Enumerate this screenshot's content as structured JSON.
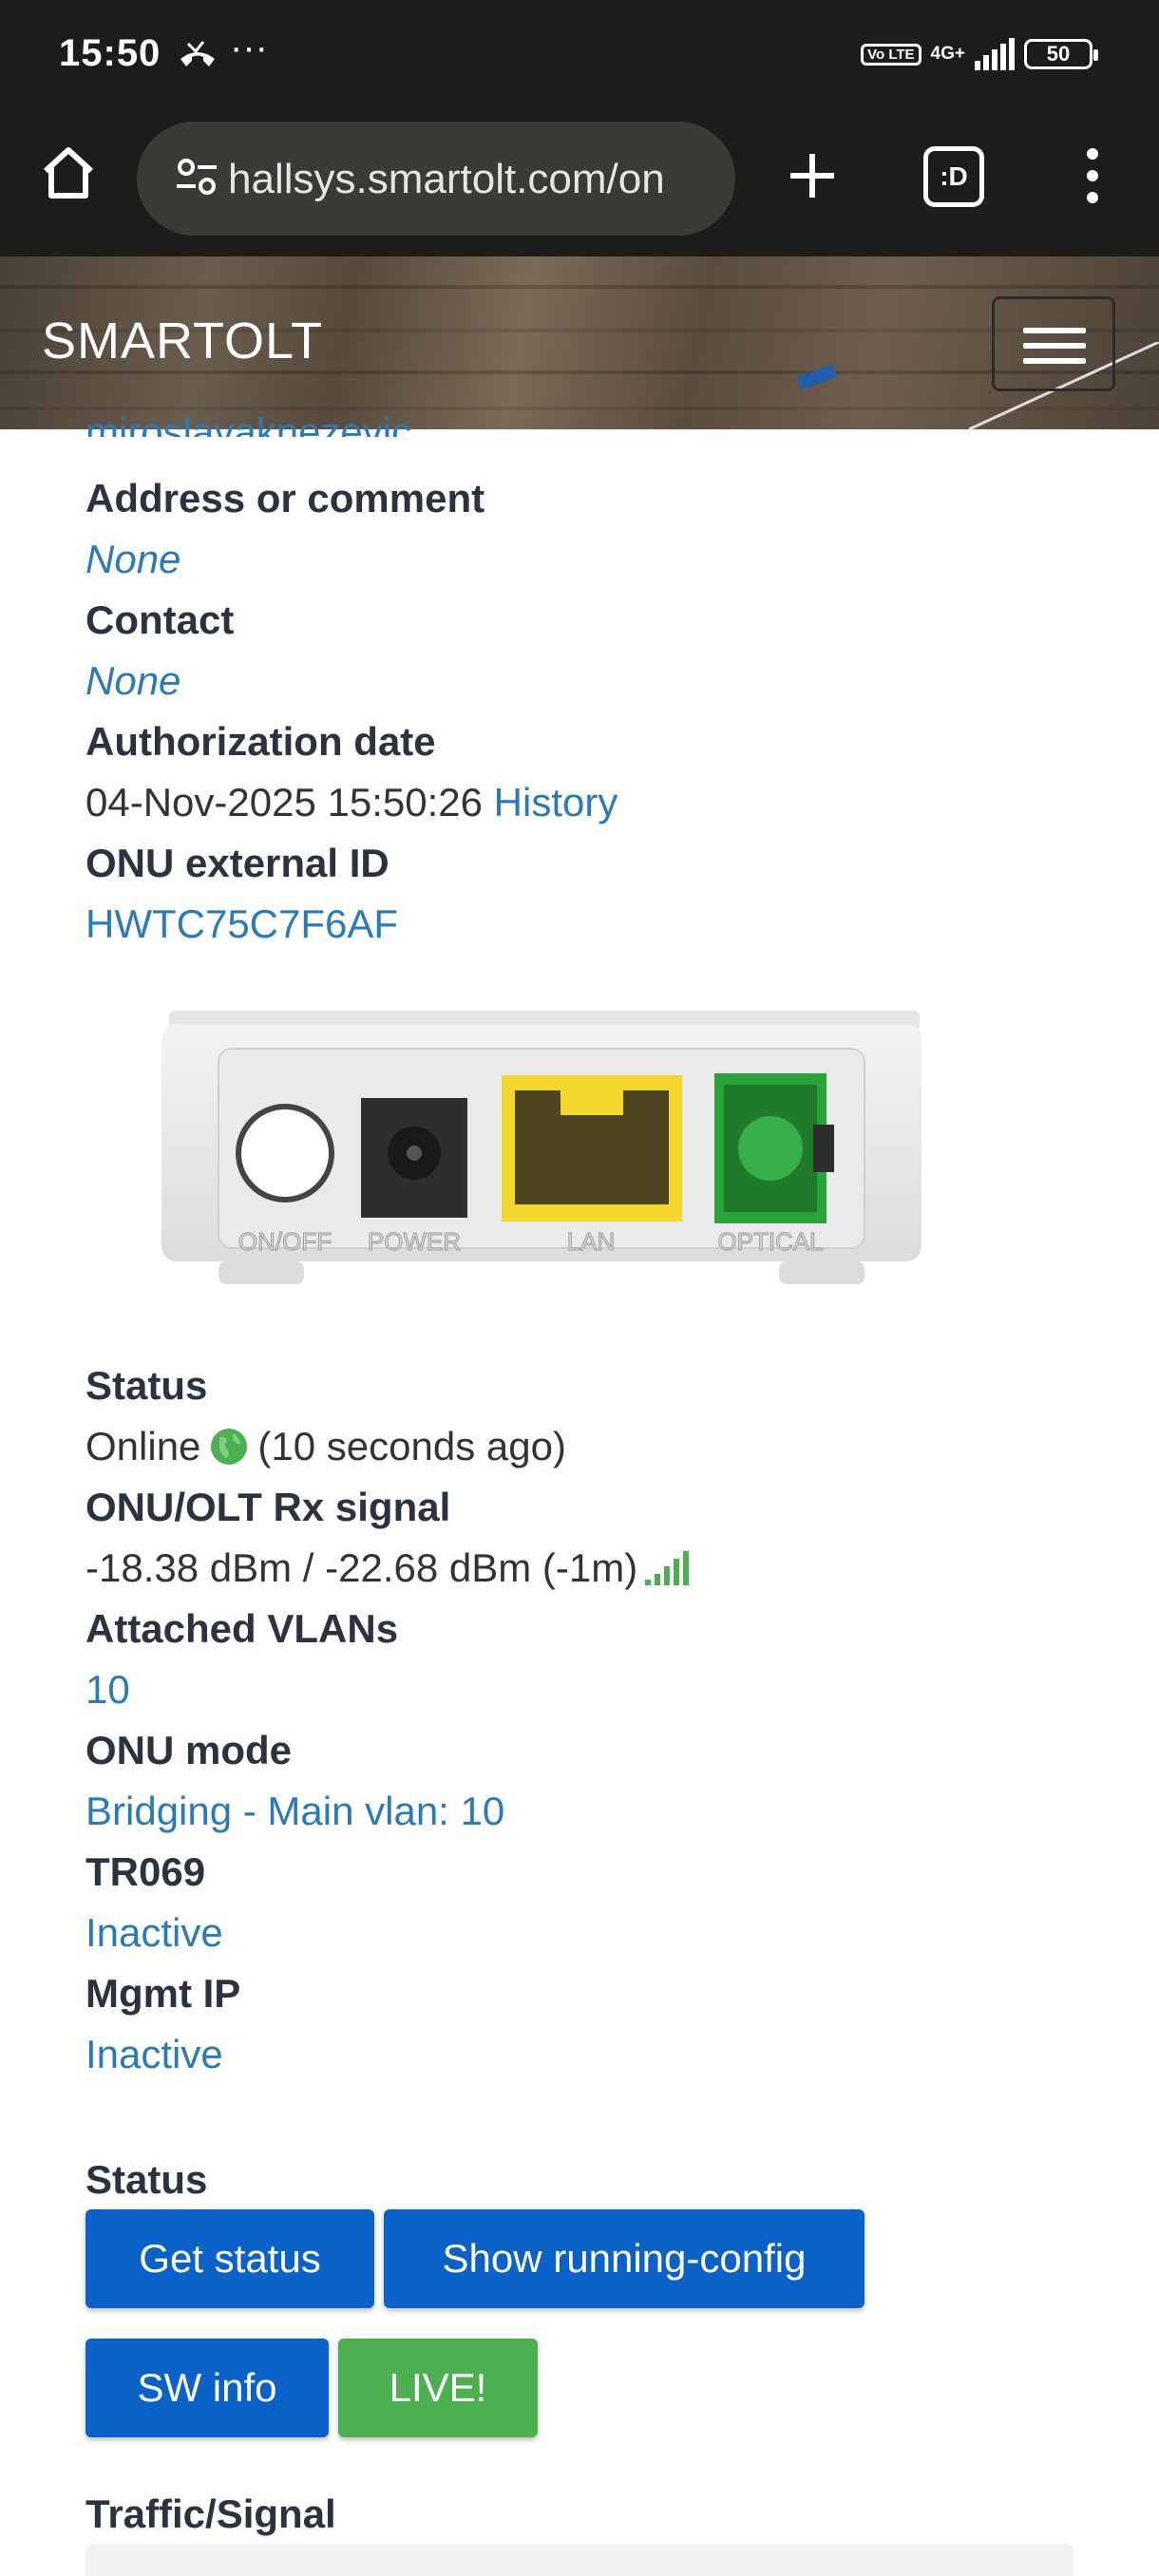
{
  "status_bar": {
    "time": "15:50",
    "more": "···",
    "network": "4G+",
    "volte": "Vo LTE",
    "battery": "50"
  },
  "browser": {
    "url": "hallsys.smartolt.com/on",
    "tabs_label": ":D"
  },
  "app": {
    "brand": "SMARTOLT"
  },
  "details": {
    "partial_user": "miroslavaknezevic",
    "address_label": "Address or comment",
    "address_value": "None",
    "contact_label": "Contact",
    "contact_value": "None",
    "auth_label": "Authorization date",
    "auth_value": "04-Nov-2025 15:50:26",
    "auth_history": "History",
    "ext_id_label": "ONU external ID",
    "ext_id_value": "HWTC75C7F6AF",
    "status_label": "Status",
    "status_value": "Online",
    "status_ago": "(10 seconds ago)",
    "rx_label": "ONU/OLT Rx signal",
    "rx_value": "-18.38 dBm / -22.68 dBm (-1m)",
    "vlans_label": "Attached VLANs",
    "vlans_value": "10",
    "mode_label": "ONU mode",
    "mode_value": "Bridging - Main vlan: 10",
    "tr069_label": "TR069",
    "tr069_value": "Inactive",
    "mgmt_label": "Mgmt IP",
    "mgmt_value": "Inactive"
  },
  "device_ports": [
    "ON/OFF",
    "POWER",
    "LAN",
    "OPTICAL"
  ],
  "actions": {
    "section_label": "Status",
    "get_status": "Get status",
    "show_config": "Show running-config",
    "sw_info": "SW info",
    "live": "LIVE!"
  },
  "traffic": {
    "section_label": "Traffic/Signal"
  },
  "colors": {
    "link": "#2a7ab8",
    "primary": "#0a62c9",
    "success": "#4caf50",
    "status_bg": "#1c1c1a"
  }
}
